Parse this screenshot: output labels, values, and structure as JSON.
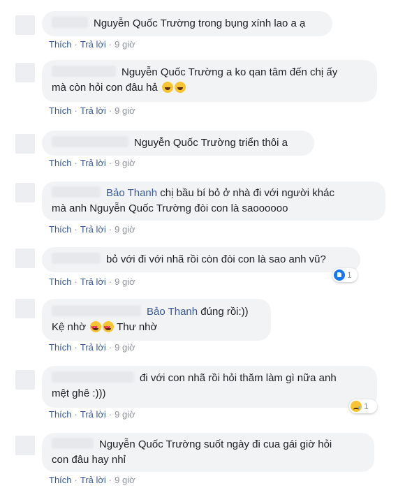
{
  "actions": {
    "like_label": "Thích",
    "reply_label": "Trả lời",
    "separator": "·",
    "time": "9 giờ"
  },
  "comments": [
    {
      "mention": "Nguyễn Quốc Trường",
      "text": " trong bụng xính lao a ạ",
      "emojis": []
    },
    {
      "mention": "Nguyễn Quốc Trường",
      "text": " a ko qan tâm đến chị ấy",
      "line2": "mà còn hỏi con đâu hả",
      "emojis": [
        "face-with-tears-of-joy-icon",
        "face-with-tears-of-joy-icon"
      ]
    },
    {
      "mention": "Nguyễn Quốc Trường",
      "text": " triển thôi a",
      "emojis": []
    },
    {
      "mention": "Bảo Thanh",
      "text": " chị bầu bí bỏ ở nhà đi với người khác",
      "line2": "mà anh Nguyễn Quốc Trường đòi con là saoooooo",
      "emojis": []
    },
    {
      "mention": "",
      "text": "bỏ với đi với nhã rồi còn đòi con là sao anh vũ?",
      "emojis": [],
      "reaction": {
        "type": "like",
        "count": "1"
      }
    },
    {
      "mention": "Bảo Thanh",
      "text": " đúng rồi:))",
      "line2a": "Kệ nhờ",
      "line2b": "Thư nhờ",
      "emojis": [
        "heart-eyes-icon",
        "heart-eyes-icon"
      ]
    },
    {
      "mention": "",
      "text": "đi với con nhã rồi hỏi thăm làm gì nữa anh",
      "line2": "mệt ghê :)))",
      "emojis": [],
      "reaction": {
        "type": "sad",
        "count": "1"
      }
    },
    {
      "mention": "Nguyễn Quốc Trường",
      "text": " suốt ngày đi cua gái giờ hỏi",
      "line2": "con đâu hay nhỉ",
      "emojis": []
    }
  ]
}
